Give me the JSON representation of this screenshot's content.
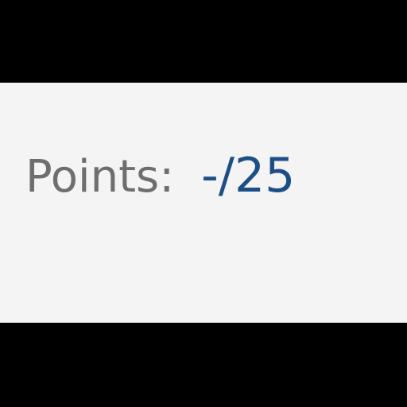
{
  "points": {
    "label": "Points:",
    "value": "-/25"
  },
  "colors": {
    "label_text": "#6e6e6e",
    "value_text": "#1d4f86",
    "panel_background": "#f4f4f4",
    "letterbox": "#000000"
  }
}
